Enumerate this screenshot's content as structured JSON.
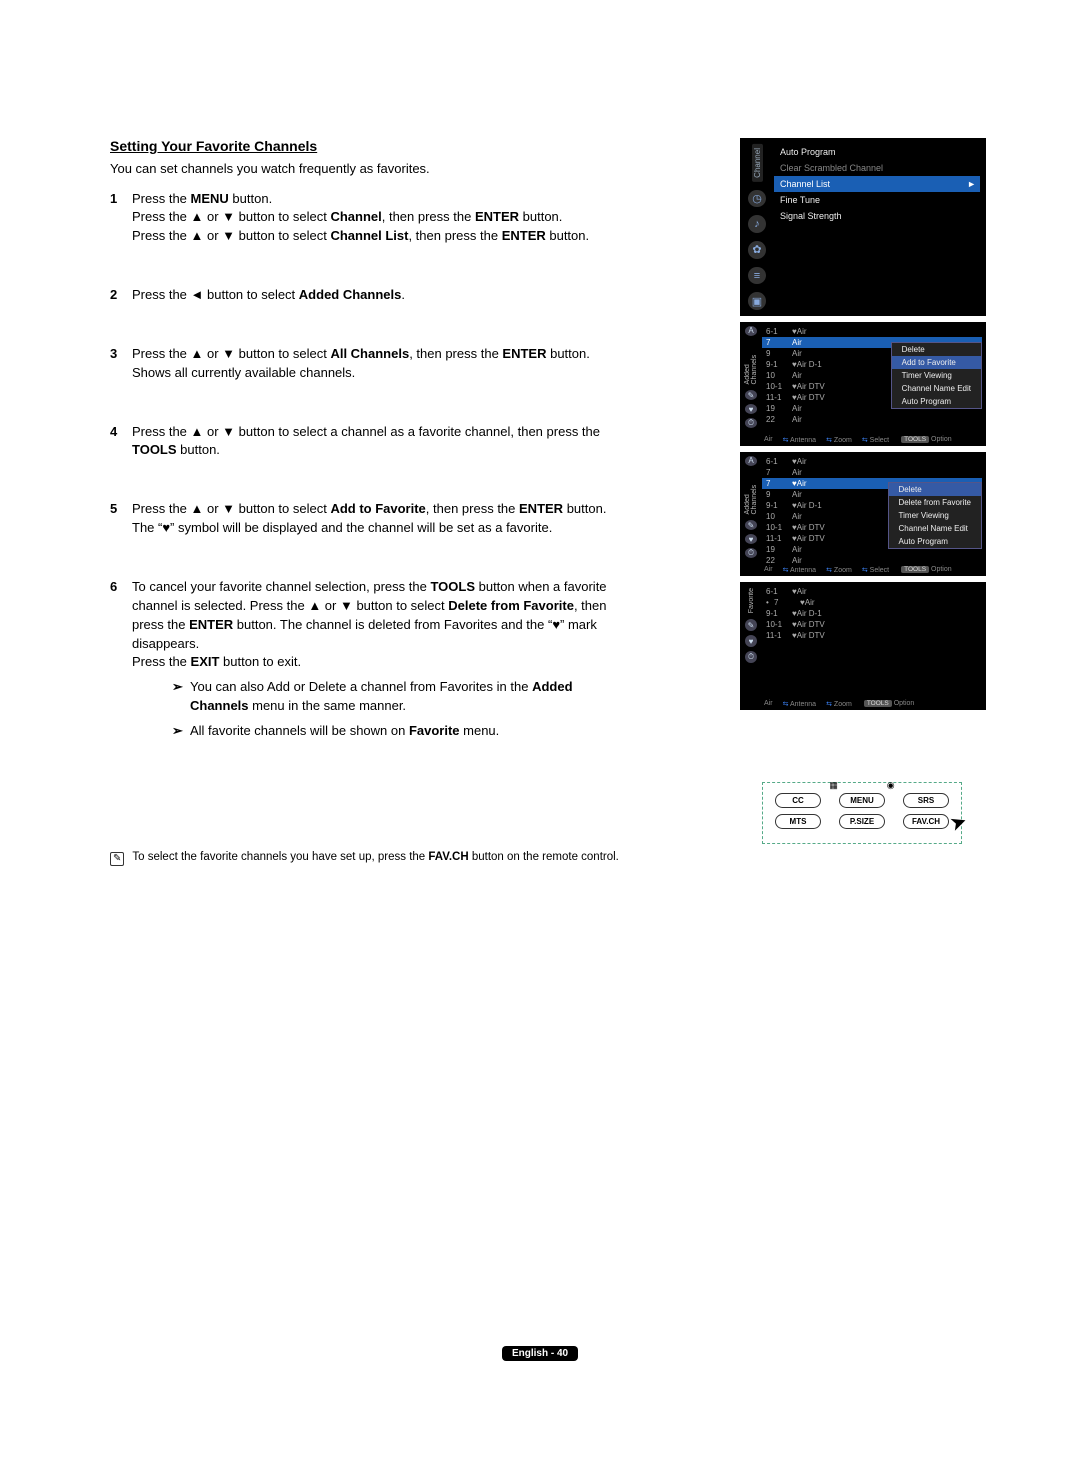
{
  "title": "Setting Your Favorite Channels",
  "intro": "You can set channels you watch frequently as favorites.",
  "steps": [
    {
      "n": "1",
      "html": "Press the <b>MENU</b> button.<br>Press the ▲ or ▼ button to select <b>Channel</b>, then press the <b>ENTER</b> button.<br>Press the ▲ or ▼ button to select <b>Channel List</b>, then press the <b>ENTER</b> button."
    },
    {
      "n": "2",
      "html": "Press the ◄ button to select <b>Added Channels</b>."
    },
    {
      "n": "3",
      "html": "Press the ▲ or ▼ button to select <b>All Channels</b>, then press the <b>ENTER</b> button. Shows all currently available channels."
    },
    {
      "n": "4",
      "html": "Press the ▲ or ▼ button to select a channel as a favorite channel, then press the <b>TOOLS</b> button."
    },
    {
      "n": "5",
      "html": "Press the ▲ or ▼ button to select <b>Add to Favorite</b>, then press the <b>ENTER</b> button.<br>The “♥” symbol will be displayed and the channel will be set as a favorite."
    },
    {
      "n": "6",
      "html": "To cancel your favorite channel selection, press the <b>TOOLS</b> button when a favorite channel is selected. Press the ▲ or ▼ button to select <b>Delete from Favorite</b>, then press the <b>ENTER</b> button. The channel is deleted from Favorites and the “♥” mark disappears.<br>Press the <b>EXIT</b> button to exit.",
      "subs": [
        "You can also Add or Delete a channel from Favorites in the <b>Added Channels</b> menu in the same manner.",
        "All favorite channels will be shown on <b>Favorite</b> menu."
      ]
    }
  ],
  "note": "To select the favorite channels you have set up, press the <b>FAV.CH</b> button on the remote control.",
  "shot1": {
    "sideLabel": "Channel",
    "items": [
      {
        "label": "Auto Program",
        "sel": false,
        "dim": false
      },
      {
        "label": "Clear Scrambled Channel",
        "sel": false,
        "dim": true
      },
      {
        "label": "Channel List",
        "sel": true,
        "dim": false
      },
      {
        "label": "Fine Tune",
        "sel": false,
        "dim": false
      },
      {
        "label": "Signal Strength",
        "sel": false,
        "dim": false
      }
    ]
  },
  "shot2": {
    "sideLabel": "Added Channels",
    "rows": [
      {
        "n": "6-1",
        "l": "♥Air"
      },
      {
        "n": "7",
        "l": "Air",
        "hi": true
      },
      {
        "n": "9",
        "l": "Air"
      },
      {
        "n": "9-1",
        "l": "♥Air D-1"
      },
      {
        "n": "10",
        "l": "Air"
      },
      {
        "n": "10-1",
        "l": "♥Air DTV"
      },
      {
        "n": "11-1",
        "l": "♥Air DTV"
      },
      {
        "n": "19",
        "l": "Air"
      },
      {
        "n": "22",
        "l": "Air"
      }
    ],
    "popup": [
      "Delete",
      "Add to Favorite",
      "Timer Viewing",
      "Channel Name Edit",
      "Auto Program"
    ],
    "popupSel": 1,
    "bar": {
      "l": "Air",
      "a": "Antenna",
      "b": "Zoom",
      "c": "Select",
      "d": "Option"
    }
  },
  "shot3": {
    "sideLabel": "Added Channels",
    "rows": [
      {
        "n": "6-1",
        "l": "♥Air"
      },
      {
        "n": "7",
        "l": "Air"
      },
      {
        "n": "7",
        "l": "♥Air",
        "hi": true
      },
      {
        "n": "9",
        "l": "Air"
      },
      {
        "n": "9-1",
        "l": "♥Air D-1"
      },
      {
        "n": "10",
        "l": "Air"
      },
      {
        "n": "10-1",
        "l": "♥Air DTV"
      },
      {
        "n": "11-1",
        "l": "♥Air DTV"
      },
      {
        "n": "19",
        "l": "Air"
      },
      {
        "n": "22",
        "l": "Air"
      }
    ],
    "popup": [
      "Delete",
      "Delete from Favorite",
      "Timer Viewing",
      "Channel Name Edit",
      "Auto Program"
    ],
    "popupSel": 0,
    "bar": {
      "l": "Air",
      "a": "Antenna",
      "b": "Zoom",
      "c": "Select",
      "d": "Option"
    }
  },
  "shot4": {
    "sideLabel": "Favorite",
    "rows": [
      {
        "n": "6-1",
        "l": "♥Air"
      },
      {
        "n": "7",
        "l": "♥Air",
        "mark": "•"
      },
      {
        "n": "9-1",
        "l": "♥Air D-1"
      },
      {
        "n": "10-1",
        "l": "♥Air DTV"
      },
      {
        "n": "11-1",
        "l": "♥Air DTV"
      }
    ],
    "bar": {
      "l": "Air",
      "a": "Antenna",
      "b": "Zoom",
      "d": "Option"
    }
  },
  "remote": {
    "row1": [
      "CC",
      "MENU",
      "SRS"
    ],
    "row2": [
      "MTS",
      "P.SIZE",
      "FAV.CH"
    ]
  },
  "footer": "English - 40"
}
